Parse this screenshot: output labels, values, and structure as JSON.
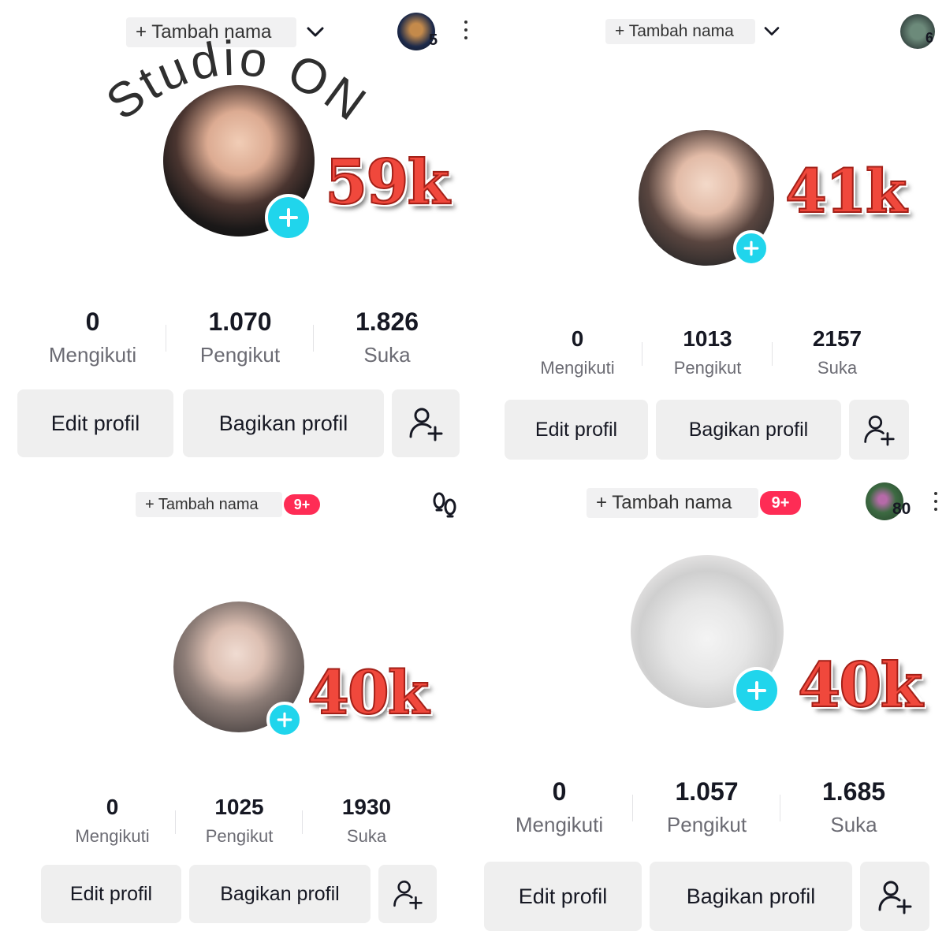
{
  "watermark": {
    "text": "Studio ON"
  },
  "panels": [
    {
      "name_pill": "+ Tambah nama",
      "mini_avatar_count": "5",
      "big_count": "59k",
      "stats": [
        {
          "value": "0",
          "label": "Mengikuti"
        },
        {
          "value": "1.070",
          "label": "Pengikut"
        },
        {
          "value": "1.826",
          "label": "Suka"
        }
      ],
      "buttons": {
        "edit": "Edit profil",
        "share": "Bagikan profil"
      }
    },
    {
      "name_pill": "+ Tambah nama",
      "mini_avatar_count": "6",
      "big_count": "41k",
      "stats": [
        {
          "value": "0",
          "label": "Mengikuti"
        },
        {
          "value": "1013",
          "label": "Pengikut"
        },
        {
          "value": "2157",
          "label": "Suka"
        }
      ],
      "buttons": {
        "edit": "Edit profil",
        "share": "Bagikan profil"
      }
    },
    {
      "name_pill": "+ Tambah nama",
      "notification_badge": "9+",
      "big_count": "40k",
      "stats": [
        {
          "value": "0",
          "label": "Mengikuti"
        },
        {
          "value": "1025",
          "label": "Pengikut"
        },
        {
          "value": "1930",
          "label": "Suka"
        }
      ],
      "buttons": {
        "edit": "Edit profil",
        "share": "Bagikan profil"
      }
    },
    {
      "name_pill": "+ Tambah nama",
      "notification_badge": "9+",
      "mini_avatar_count": "80",
      "big_count": "40k",
      "stats": [
        {
          "value": "0",
          "label": "Mengikuti"
        },
        {
          "value": "1.057",
          "label": "Pengikut"
        },
        {
          "value": "1.685",
          "label": "Suka"
        }
      ],
      "buttons": {
        "edit": "Edit profil",
        "share": "Bagikan profil"
      }
    }
  ],
  "colors": {
    "accent_plus": "#20d5ec",
    "badge_red": "#fe2c55",
    "big_count_red": "#f0483c",
    "button_bg": "#efefef"
  },
  "icons": [
    "chevron-down-icon",
    "more-vertical-icon",
    "add-friend-icon",
    "plus-icon",
    "footprints-icon"
  ]
}
